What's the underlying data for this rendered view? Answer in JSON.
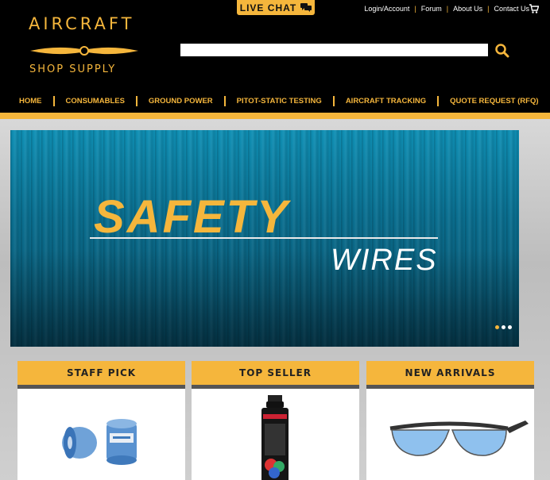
{
  "brand": {
    "line1": "AIRCRAFT",
    "line2": "SHOP SUPPLY",
    "color": "#f5b63c"
  },
  "live_chat": {
    "label": "LIVE CHAT",
    "icon": "chat-bubble-icon"
  },
  "top_links": [
    "Login/Account",
    "Forum",
    "About Us",
    "Contact Us"
  ],
  "search": {
    "placeholder": ""
  },
  "nav": [
    "HOME",
    "CONSUMABLES",
    "GROUND POWER",
    "PITOT-STATIC TESTING",
    "AIRCRAFT TRACKING",
    "QUOTE REQUEST (RFQ)"
  ],
  "hero": {
    "title": "SAFETY",
    "subtitle": "WIRES",
    "slides": 3,
    "active_slide": 1
  },
  "cards": [
    {
      "heading": "STAFF PICK",
      "image": "safety-wire-spools"
    },
    {
      "heading": "TOP SELLER",
      "image": "spray-paint-can"
    },
    {
      "heading": "NEW ARRIVALS",
      "image": "safety-glasses"
    }
  ]
}
